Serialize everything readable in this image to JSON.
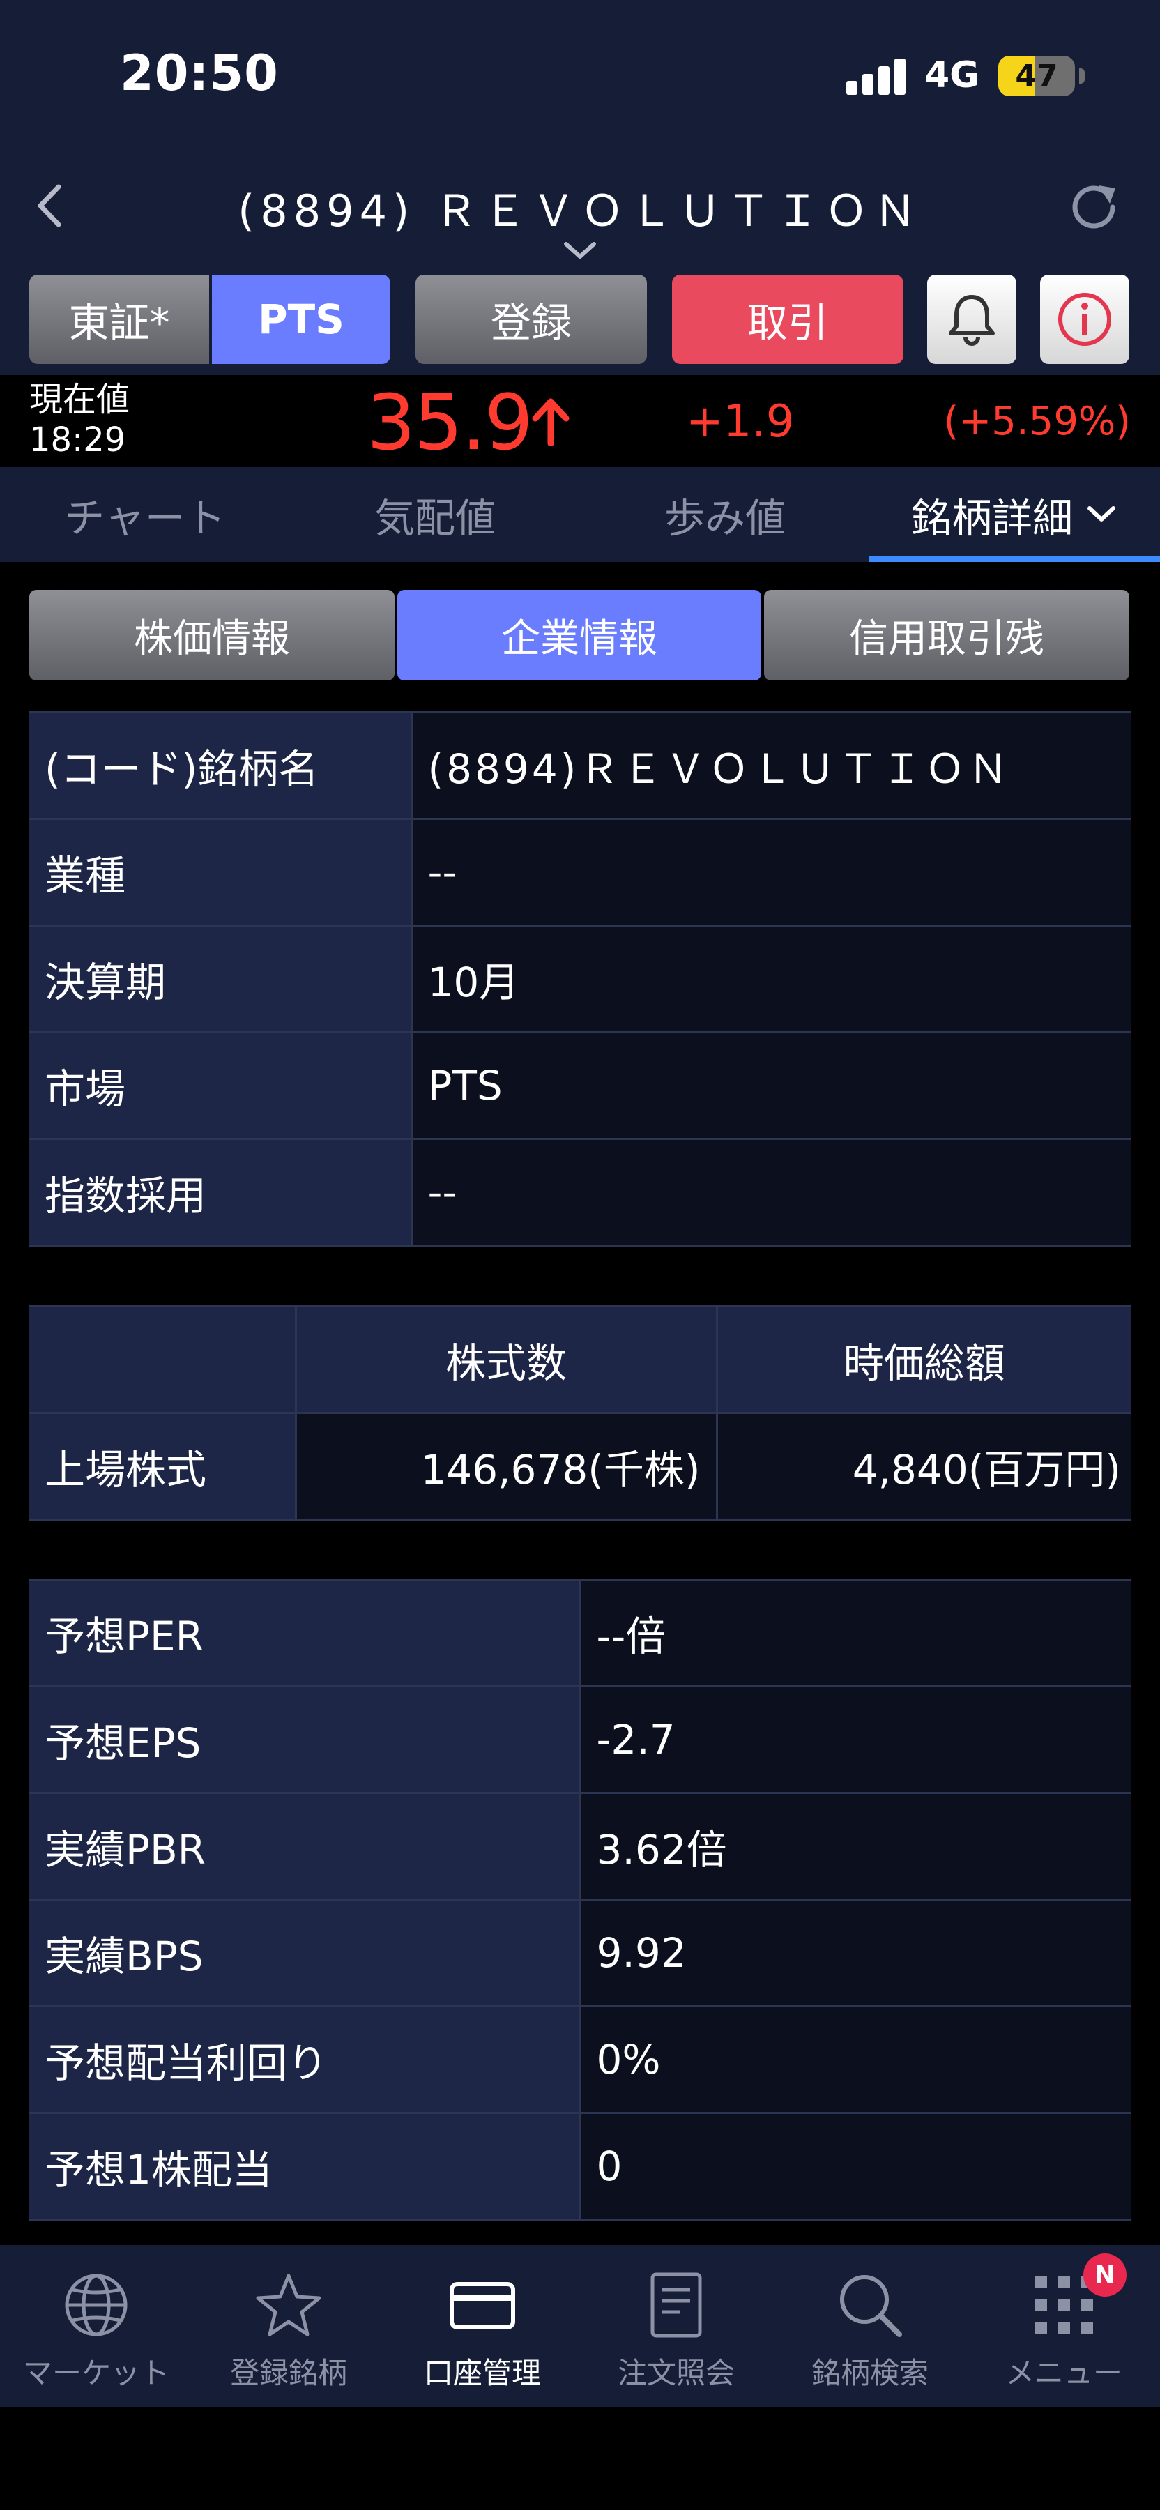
{
  "status_bar": {
    "time": "20:50",
    "network": "4G",
    "battery": "47",
    "battery_level": 0.47
  },
  "header": {
    "title": "(8894) ＲＥＶＯＬＵＴＩＯＮ"
  },
  "actions": {
    "market_tse": "東証*",
    "market_pts": "PTS",
    "register": "登録",
    "trade": "取引"
  },
  "quote": {
    "label": "現在値",
    "time": "18:29",
    "price": "35.9",
    "change": "+1.9",
    "change_pct": "(+5.59%)"
  },
  "tabs": [
    {
      "label": "チャート"
    },
    {
      "label": "気配値"
    },
    {
      "label": "歩み値"
    },
    {
      "label": "銘柄詳細"
    }
  ],
  "segments": [
    {
      "label": "株価情報"
    },
    {
      "label": "企業情報"
    },
    {
      "label": "信用取引残"
    }
  ],
  "company_info": [
    {
      "key": "(コード)銘柄名",
      "value": "(8894)ＲＥＶＯＬＵＴＩＯＮ"
    },
    {
      "key": "業種",
      "value": "--"
    },
    {
      "key": "決算期",
      "value": "10月"
    },
    {
      "key": "市場",
      "value": "PTS"
    },
    {
      "key": "指数採用",
      "value": "--"
    }
  ],
  "shares_table": {
    "headers": [
      "",
      "株式数",
      "時価総額"
    ],
    "row": {
      "label": "上場株式",
      "shares": "146,678(千株)",
      "market_cap": "4,840(百万円)"
    }
  },
  "metrics": [
    {
      "key": "予想PER",
      "value": "--倍"
    },
    {
      "key": "予想EPS",
      "value": "-2.7"
    },
    {
      "key": "実績PBR",
      "value": "3.62倍"
    },
    {
      "key": "実績BPS",
      "value": "9.92"
    },
    {
      "key": "予想配当利回り",
      "value": "0%"
    },
    {
      "key": "予想1株配当",
      "value": "0"
    }
  ],
  "bottom_nav": [
    {
      "label": "マーケット",
      "icon": "globe-icon"
    },
    {
      "label": "登録銘柄",
      "icon": "star-icon"
    },
    {
      "label": "口座管理",
      "icon": "card-icon"
    },
    {
      "label": "注文照会",
      "icon": "document-icon"
    },
    {
      "label": "銘柄検索",
      "icon": "search-icon"
    },
    {
      "label": "メニュー",
      "icon": "grid-icon"
    }
  ],
  "menu_badge": "N",
  "colors": {
    "accent_blue": "#6b7dff",
    "trade_red": "#e94a5e",
    "price_red": "#ff3b30",
    "nav_bg": "#161d37"
  }
}
